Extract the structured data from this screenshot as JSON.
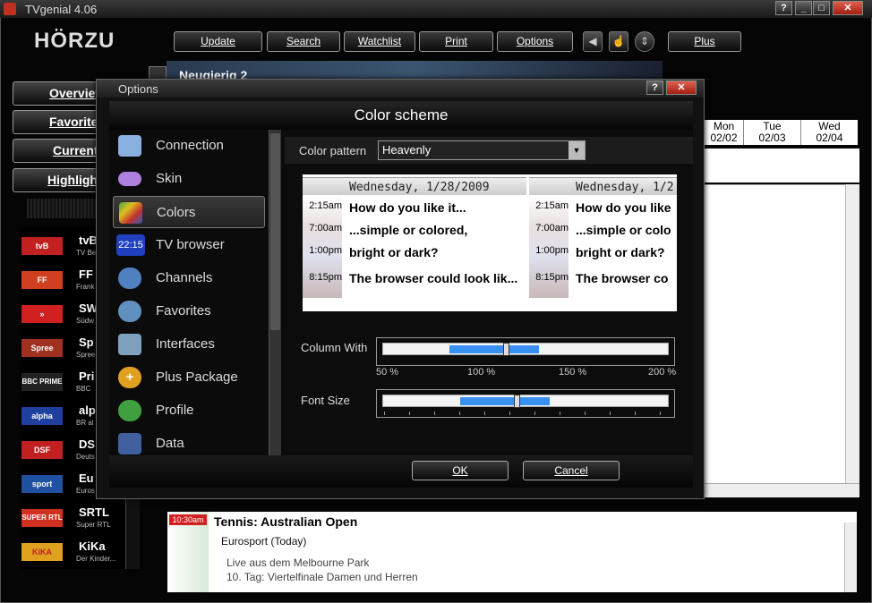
{
  "app": {
    "title": "TVgenial 4.06",
    "logo": "HÖRZU"
  },
  "toolbar": {
    "update": "Update",
    "search": "Search",
    "watchlist": "Watchlist",
    "print": "Print",
    "options": "Options",
    "plus": "Plus"
  },
  "nav": {
    "overview": "Overview",
    "favorites": "Favorites",
    "current": "Current",
    "highlights": "Highlights"
  },
  "banner": {
    "text": "Neugierig 2"
  },
  "days": [
    {
      "name": "Mon",
      "date": "02/02"
    },
    {
      "name": "Tue",
      "date": "02/03"
    },
    {
      "name": "Wed",
      "date": "02/04"
    }
  ],
  "channels": [
    {
      "logo": "tvB",
      "name": "tvB",
      "sub": "TV Be",
      "color": "#c02020"
    },
    {
      "logo": "FF",
      "name": "FF",
      "sub": "Frank",
      "color": "#d04020"
    },
    {
      "logo": "»",
      "name": "SW",
      "sub": "Südw",
      "color": "#d02020"
    },
    {
      "logo": "Spree",
      "name": "Sp",
      "sub": "Spree",
      "color": "#a03020"
    },
    {
      "logo": "BBC PRIME",
      "name": "Pri",
      "sub": "BBC",
      "color": "#222222"
    },
    {
      "logo": "alpha",
      "name": "alp",
      "sub": "BR al",
      "color": "#2040a0"
    },
    {
      "logo": "DSF",
      "name": "DS",
      "sub": "Deuts",
      "color": "#c02020"
    },
    {
      "logo": "sport",
      "name": "Eu",
      "sub": "Euros",
      "color": "#2050a0"
    },
    {
      "logo": "SUPER RTL",
      "name": "SRTL",
      "sub": "Super RTL",
      "color": "#d03020"
    },
    {
      "logo": "KiKA",
      "name": "KiKa",
      "sub": "Der Kinder...",
      "color": "#e0a020"
    }
  ],
  "detail": {
    "time": "10:30am",
    "title": "Tennis: Australian Open",
    "channel": "Eurosport  (Today)",
    "line1": "Live aus dem Melbourne Park",
    "line2": "10. Tag: Viertelfinale Damen und Herren"
  },
  "dialog": {
    "title": "Options",
    "heading": "Color scheme",
    "sidebar": [
      {
        "label": "Connection",
        "icon": "connection-icon",
        "color": "#8ab0e0"
      },
      {
        "label": "Skin",
        "icon": "skin-icon",
        "color": "#b080e0"
      },
      {
        "label": "Colors",
        "icon": "colors-icon",
        "color": "#40a040",
        "selected": true
      },
      {
        "label": "TV browser",
        "icon": "tv-browser-icon",
        "color": "#2040c0"
      },
      {
        "label": "Channels",
        "icon": "channels-icon",
        "color": "#5080c0"
      },
      {
        "label": "Favorites",
        "icon": "favorites-icon",
        "color": "#6090c0"
      },
      {
        "label": "Interfaces",
        "icon": "interfaces-icon",
        "color": "#80a0c0"
      },
      {
        "label": "Plus Package",
        "icon": "plus-package-icon",
        "color": "#e0a020"
      },
      {
        "label": "Profile",
        "icon": "profile-icon",
        "color": "#40a040"
      },
      {
        "label": "Data",
        "icon": "data-icon",
        "color": "#4060a0"
      }
    ],
    "tvbrowser_badge": "22:15",
    "color_pattern_label": "Color pattern",
    "color_pattern_value": "Heavenly",
    "preview": {
      "header": "Wednesday, 1/28/2009",
      "header_cut": "Wednesday, 1/2",
      "times": [
        "2:15am",
        "7:00am",
        "1:00pm",
        "8:15pm"
      ],
      "lines": [
        "How do you like it...",
        "...simple or colored,",
        "bright or dark?",
        "The browser could look lik..."
      ],
      "lines_cut": [
        "How do you like",
        "...simple or colo",
        "bright or dark?",
        "The browser co"
      ]
    },
    "column_width_label": "Column With",
    "column_width_ticks": [
      "50 %",
      "100 %",
      "150 %",
      "200 %"
    ],
    "column_width_value": 0.42,
    "font_size_label": "Font Size",
    "font_size_value": 0.46,
    "ok": "OK",
    "cancel": "Cancel"
  }
}
